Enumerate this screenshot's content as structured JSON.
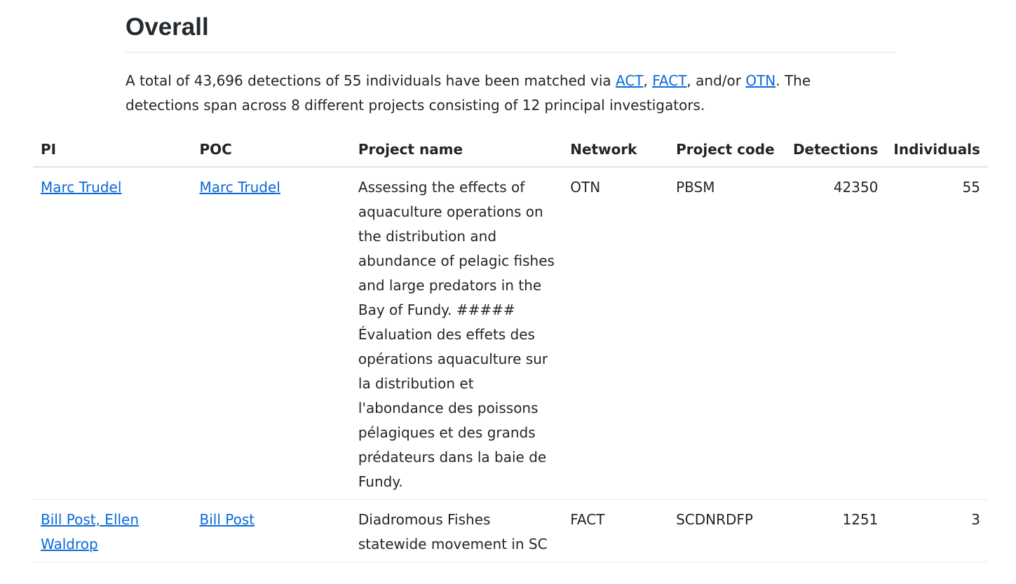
{
  "heading": "Overall",
  "summary": {
    "text_before": "A total of 43,696 detections of 55 individuals have been matched via ",
    "link_act": "ACT",
    "sep1": ", ",
    "link_fact": "FACT",
    "sep2": ", and/or ",
    "link_otn": "OTN",
    "text_after": ". The detections span across 8 different projects consisting of 12 principal investigators."
  },
  "table": {
    "headers": {
      "pi": "PI",
      "poc": "POC",
      "project_name": "Project name",
      "network": "Network",
      "project_code": "Project code",
      "detections": "Detections",
      "individuals": "Individuals"
    },
    "rows": [
      {
        "pi": "Marc Trudel",
        "poc": "Marc Trudel",
        "project_name": "Assessing the effects of aquaculture operations on the distribution and abundance of pelagic fishes and large predators in the Bay of Fundy. ##### Évaluation des effets des opérations aquaculture sur la distribution et l'abondance des poissons pélagiques et des grands prédateurs dans la baie de Fundy.",
        "network": "OTN",
        "project_code": "PBSM",
        "detections": "42350",
        "individuals": "55"
      },
      {
        "pi": "Bill Post, Ellen Waldrop",
        "poc": "Bill Post",
        "project_name": "Diadromous Fishes statewide movement in SC",
        "network": "FACT",
        "project_code": "SCDNRDFP",
        "detections": "1251",
        "individuals": "3"
      }
    ]
  }
}
